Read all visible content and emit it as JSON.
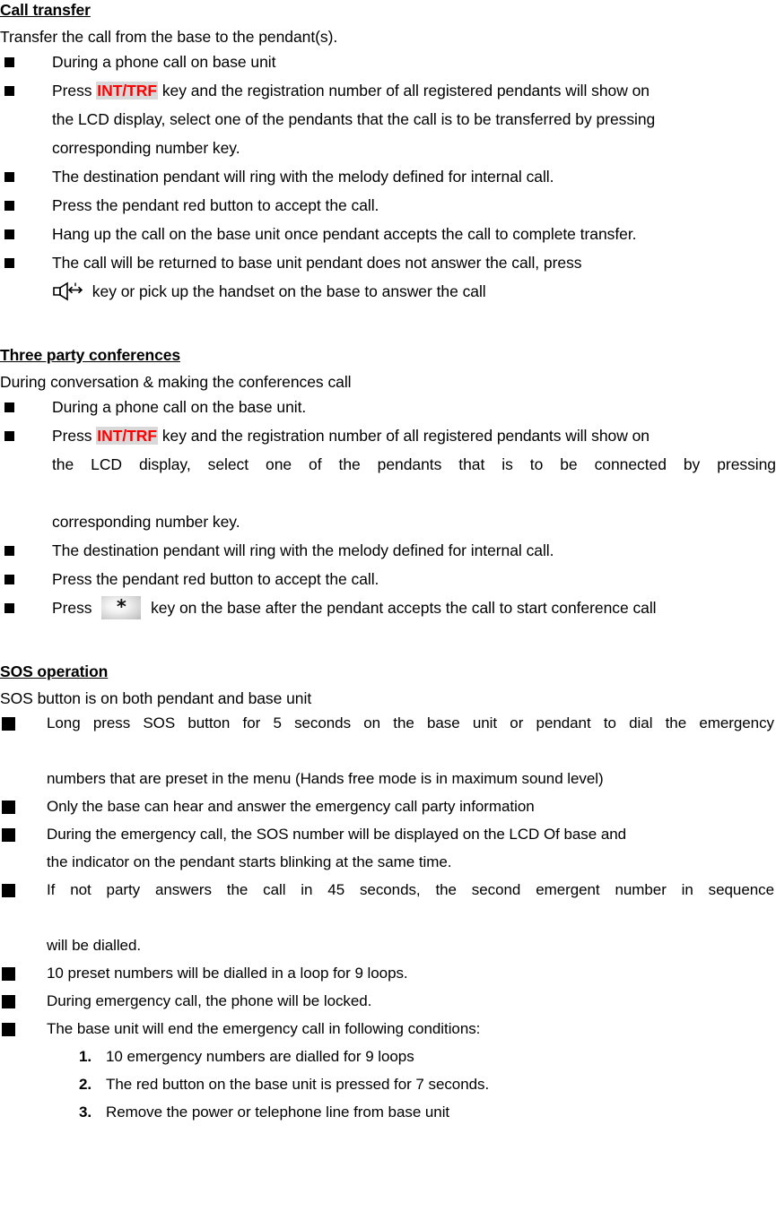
{
  "document": {
    "sections": [
      {
        "id": "call-transfer",
        "heading": "Call transfer",
        "intro": "Transfer the call from the base to the pendant(s).",
        "bullets": [
          {
            "text": "During a phone call on base unit"
          },
          {
            "pre": "Press ",
            "key": "INT/TRF",
            "post": " key and the registration number of all registered pendants will show on",
            "cont": [
              "the LCD display, select one of the pendants that the call is to be transferred by pressing",
              "corresponding number key."
            ]
          },
          {
            "text": "The destination pendant will ring with the melody defined for internal call."
          },
          {
            "text": "Press the pendant red button to accept the call."
          },
          {
            "text": "Hang up the call on the base unit once pendant accepts the call to complete transfer."
          },
          {
            "text": "The call will be returned to base unit pendant does not answer the call, press",
            "icon": "speaker-icon",
            "icon_cont": " key or pick up the handset on the base to answer the call"
          }
        ]
      },
      {
        "id": "three-party-conferences",
        "heading": "Three party conferences",
        "intro": "During conversation & making the conferences call",
        "bullets": [
          {
            "text": "During a phone call on the base unit."
          },
          {
            "pre": "Press ",
            "key": "INT/TRF",
            "post": " key and the registration number of all registered pendants will show on",
            "cont_justified": "the LCD display, select one of the pendants that is to be connected by pressing",
            "cont": [
              "corresponding number key."
            ]
          },
          {
            "text": "The destination pendant will ring with the melody defined for internal call."
          },
          {
            "text": "Press the pendant red button to accept the call."
          },
          {
            "pre": "Press ",
            "star_key": "*",
            "post": " key on the base after the pendant accepts the call to start conference call"
          }
        ]
      },
      {
        "id": "sos-operation",
        "heading": "SOS operation",
        "intro": "SOS button is on both pendant and base unit",
        "bullets": [
          {
            "text": "Long press SOS button for 5 seconds on the base unit or pendant to dial the emergency",
            "cont": [
              "numbers that are preset in the menu (Hands free mode is in maximum sound level)"
            ]
          },
          {
            "text": "Only the base can hear and answer the emergency call party information"
          },
          {
            "text": "During the emergency call, the SOS number will be displayed on the LCD Of base and",
            "cont": [
              "the indicator on the pendant starts blinking at the same time."
            ]
          },
          {
            "text": "If not party answers the call in 45 seconds, the second emergent number in sequence",
            "justified": true,
            "cont": [
              "will be dialled."
            ]
          },
          {
            "text": "10 preset numbers will be dialled in a loop for 9 loops."
          },
          {
            "text": "During emergency call, the phone will be locked."
          },
          {
            "text": "The base unit will end the emergency call in following conditions:"
          }
        ],
        "numbered": [
          {
            "num": "1.",
            "text": "10 emergency numbers are dialled for 9 loops"
          },
          {
            "num": "2.",
            "text": "The red button on the base unit is pressed for 7 seconds."
          },
          {
            "num": "3.",
            "text": "Remove the power or telephone line from base unit"
          }
        ]
      }
    ]
  },
  "colors": {
    "key_text": "#ff0000",
    "key_highlight": "#d9d9d9",
    "text": "#000000",
    "background": "#ffffff"
  }
}
